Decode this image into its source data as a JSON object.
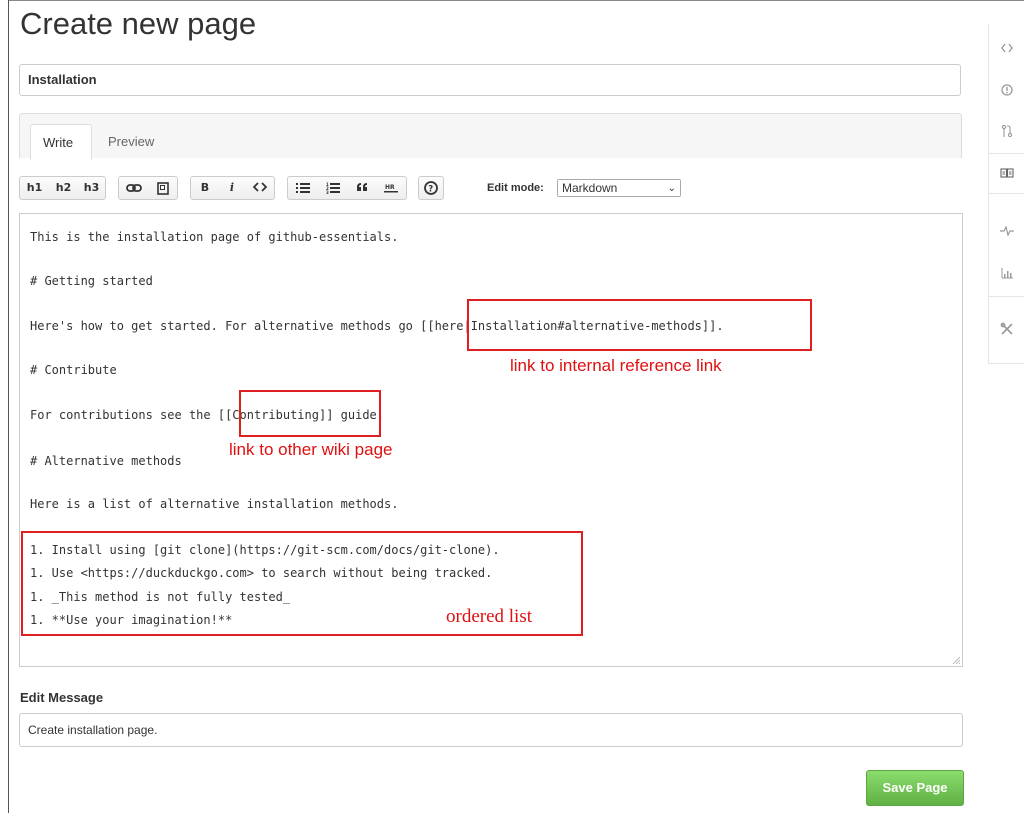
{
  "page": {
    "title": "Create new page",
    "page_name_value": "Installation"
  },
  "tabs": [
    {
      "label": "Write",
      "active": true
    },
    {
      "label": "Preview",
      "active": false
    }
  ],
  "toolbar": {
    "h1": "h1",
    "h2": "h2",
    "h3": "h3",
    "bold": "B",
    "italic": "i",
    "edit_mode_label": "Edit mode:",
    "edit_mode_value": "Markdown",
    "icons": [
      "link-icon",
      "image-icon",
      "code-icon",
      "unordered-list-icon",
      "ordered-list-icon",
      "blockquote-icon",
      "horizontal-rule-icon",
      "help-icon"
    ]
  },
  "editor": {
    "lines": [
      "This is the installation page of github-essentials.",
      "# Getting started",
      "Here's how to get started. For alternative methods go [[here|Installation#alternative-methods]].",
      "# Contribute",
      "For contributions see the [[Contributing]] guide.",
      "# Alternative methods",
      "Here is a list of alternative installation methods.",
      "1. Install using [git clone](https://git-scm.com/docs/git-clone).",
      "1. Use <https://duckduckgo.com> to search without being tracked.",
      "1. _This method is not fully tested_",
      "1. **Use your imagination!**"
    ]
  },
  "annotations": {
    "internal_link": "link to internal reference link",
    "wiki_link": "link to other wiki page",
    "ordered_list": "ordered list",
    "color": "#e02020"
  },
  "edit_message": {
    "label": "Edit Message",
    "value": "Create installation page."
  },
  "save_button": {
    "label": "Save Page",
    "color": "#60b044"
  },
  "side_nav": [
    "code-icon",
    "issues-icon",
    "pull-request-icon",
    "wiki-icon",
    "pulse-icon",
    "graphs-icon",
    "settings-icon"
  ],
  "colors": {
    "accent": "#d26911"
  }
}
